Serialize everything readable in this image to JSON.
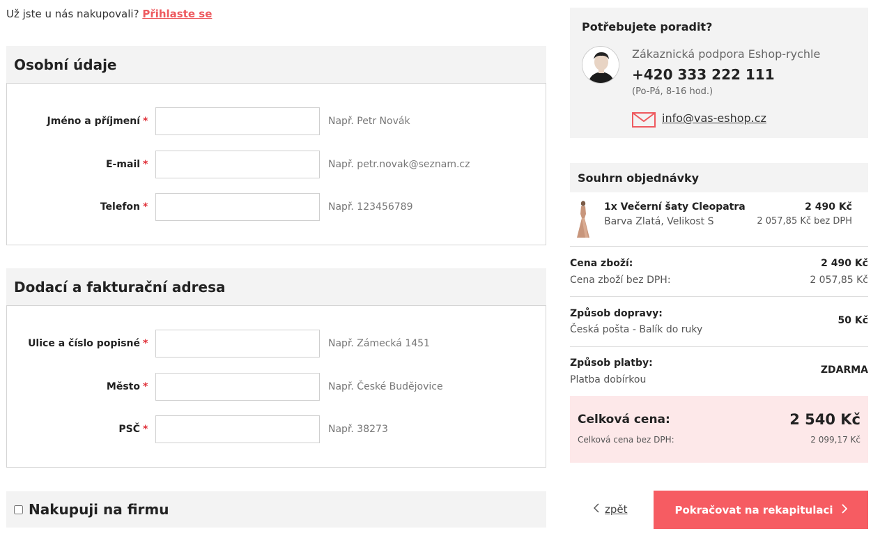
{
  "login": {
    "question": "Už jste u nás nakupovali?",
    "link": "Přihlaste se"
  },
  "personal": {
    "title": "Osobní údaje",
    "fields": [
      {
        "label": "Jméno a příjmení",
        "required": "*",
        "value": "",
        "hint": "Např. Petr Novák"
      },
      {
        "label": "E-mail",
        "required": "*",
        "value": "",
        "hint": "Např. petr.novak@seznam.cz"
      },
      {
        "label": "Telefon",
        "required": "*",
        "value": "",
        "hint": "Např. 123456789"
      }
    ]
  },
  "address": {
    "title": "Dodací a fakturační adresa",
    "fields": [
      {
        "label": "Ulice a číslo popisné",
        "required": "*",
        "value": "",
        "hint": "Např. Zámecká 1451"
      },
      {
        "label": "Město",
        "required": "*",
        "value": "",
        "hint": "Např. České Budějovice"
      },
      {
        "label": "PSČ",
        "required": "*",
        "value": "",
        "hint": "Např. 38273"
      }
    ]
  },
  "company": {
    "label": "Nakupuji na firmu",
    "checked": false
  },
  "help": {
    "title": "Potřebujete poradit?",
    "name": "Zákaznická podpora Eshop-rychle",
    "phone": "+420 333 222 111",
    "hours": "(Po-Pá, 8-16 hod.)",
    "email": " info@vas-eshop.cz",
    "mail_icon_color": "#ee5a5f"
  },
  "summary": {
    "title": "Souhrn objednávky",
    "product": {
      "name": "1x Večerní šaty Cleopatra",
      "variant": "Barva Zlatá, Velikost S",
      "price": "2 490 Kč",
      "price_net": "2 057,85 Kč bez DPH"
    },
    "goods": {
      "label": "Cena zboží:",
      "value": "2 490 Kč",
      "sub_label": "Cena zboží bez DPH:",
      "sub_value": "2 057,85 Kč"
    },
    "shipping": {
      "label": "Způsob dopravy:",
      "sub_label": "Česká pošta - Balík do ruky",
      "value": "50 Kč"
    },
    "payment": {
      "label": "Způsob platby:",
      "sub_label": "Platba dobírkou",
      "value": "ZDARMA"
    },
    "total": {
      "label": "Celková cena:",
      "value": "2 540 Kč",
      "sub_label": "Celková cena bez DPH:",
      "sub_value": "2 099,17 Kč"
    }
  },
  "nav": {
    "back": "zpět",
    "continue": "Pokračovat na rekapitulaci"
  },
  "colors": {
    "accent": "#f65c62",
    "link": "#ee5a5f",
    "panel": "#f3f3f3",
    "total_bg": "#fde8e9"
  }
}
